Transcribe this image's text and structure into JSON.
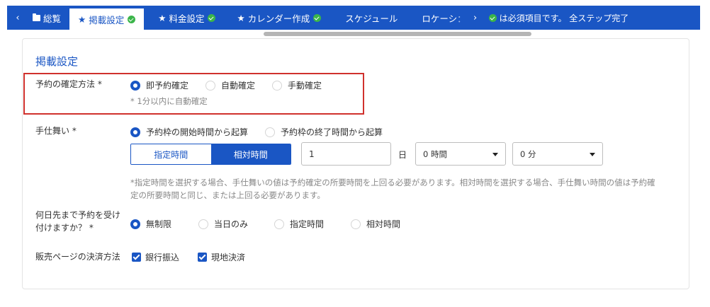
{
  "tabs": {
    "overview": "総覧",
    "listing": "掲載設定",
    "pricing": "料金設定",
    "calendar": "カレンダー作成",
    "schedule": "スケジュール",
    "location": "ロケーシ",
    "status_text": "は必須項目です。 全ステップ完了"
  },
  "section": {
    "title": "掲載設定"
  },
  "confirm": {
    "label": "予約の確定方法 *",
    "options": [
      "即予約確定",
      "自動確定",
      "手動確定"
    ],
    "selected": "即予約確定",
    "note": "* 1分以内に自動確定"
  },
  "lead": {
    "label": "手仕舞い *",
    "options": [
      "予約枠の開始時間から起算",
      "予約枠の終了時間から起算"
    ],
    "selected": "予約枠の開始時間から起算",
    "mode_options": [
      "指定時間",
      "相対時間"
    ],
    "mode_selected": "相対時間",
    "days_value": "1",
    "days_unit": "日",
    "hours_value": "0 時間",
    "minutes_value": "0 分",
    "note_line1": "*指定時間を選択する場合、手仕舞いの値は予約確定の所要時間を上回る必要があります。相対時間を選択する場合、手仕舞い時間の値は予約確",
    "note_line2": "定の所要時間と同じ、または上回る必要があります。"
  },
  "advance": {
    "label_line1": "何日先まで予約を受け",
    "label_line2": "付けますか？ *",
    "options": [
      "無制限",
      "当日のみ",
      "指定時間",
      "相対時間"
    ],
    "selected": "無制限"
  },
  "payment": {
    "label": "販売ページの決済方法",
    "options": [
      "銀行振込",
      "現地決済"
    ],
    "checked": [
      true,
      true
    ]
  },
  "colors": {
    "brand": "#1a56c4",
    "success": "#3bb54a",
    "highlight": "#d0312d"
  }
}
